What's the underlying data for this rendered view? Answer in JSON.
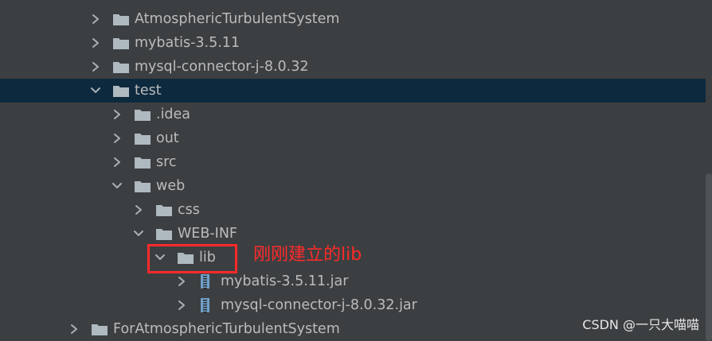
{
  "tree": [
    {
      "label": "AtmosphericTurbulentSystem",
      "type": "folder",
      "expanded": false
    },
    {
      "label": "mybatis-3.5.11",
      "type": "folder",
      "expanded": false
    },
    {
      "label": "mysql-connector-j-8.0.32",
      "type": "folder",
      "expanded": false
    },
    {
      "label": "test",
      "type": "folder",
      "expanded": true,
      "selected": true
    },
    {
      "label": ".idea",
      "type": "folder",
      "expanded": false
    },
    {
      "label": "out",
      "type": "folder",
      "expanded": false
    },
    {
      "label": "src",
      "type": "folder",
      "expanded": false
    },
    {
      "label": "web",
      "type": "folder",
      "expanded": true
    },
    {
      "label": "css",
      "type": "folder",
      "expanded": false
    },
    {
      "label": "WEB-INF",
      "type": "folder",
      "expanded": true
    },
    {
      "label": "lib",
      "type": "folder",
      "expanded": true
    },
    {
      "label": "mybatis-3.5.11.jar",
      "type": "jar",
      "expanded": false
    },
    {
      "label": "mysql-connector-j-8.0.32.jar",
      "type": "jar",
      "expanded": false
    },
    {
      "label": "ForAtmosphericTurbulentSystem",
      "type": "folder",
      "expanded": false
    }
  ],
  "annotation": {
    "text": "刚刚建立的lib",
    "color": "#ff2a2a"
  },
  "watermark": "CSDN @一只大喵喵",
  "colors": {
    "background": "#3c3f41",
    "selection": "#0d293e",
    "text": "#bbbbbb",
    "folder_icon": "#aeb9c0",
    "jar_icon": "#6f9fc8"
  }
}
